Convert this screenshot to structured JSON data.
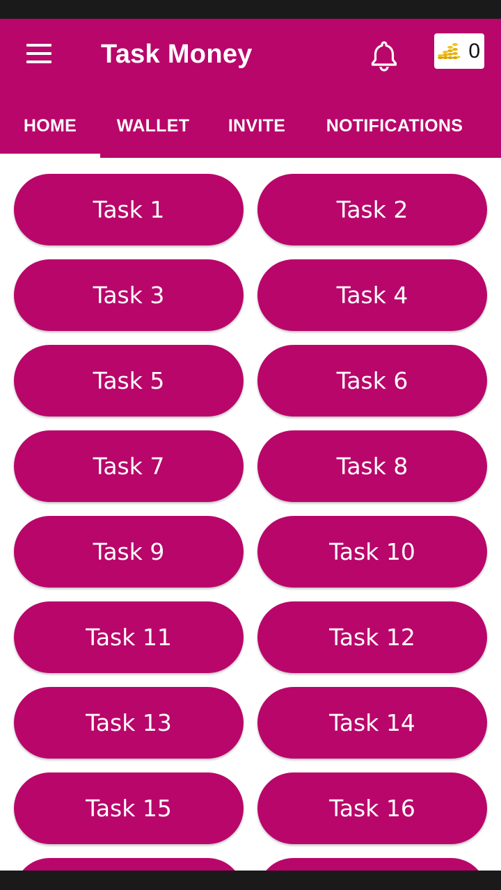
{
  "app": {
    "title": "Task Money",
    "coin_count": "0"
  },
  "colors": {
    "primary": "#b9066a",
    "status_bar": "#1a1a1a",
    "background": "#ffffff"
  },
  "icons": {
    "menu": "menu-icon",
    "bell": "bell-icon",
    "coins": "coins-icon"
  },
  "tabs": [
    {
      "label": "HOME",
      "selected": true
    },
    {
      "label": "WALLET",
      "selected": false
    },
    {
      "label": "INVITE",
      "selected": false
    },
    {
      "label": "NOTIFICATIONS",
      "selected": false
    }
  ],
  "tasks": [
    "Task 1",
    "Task 2",
    "Task 3",
    "Task 4",
    "Task 5",
    "Task 6",
    "Task 7",
    "Task 8",
    "Task 9",
    "Task 10",
    "Task 11",
    "Task 12",
    "Task 13",
    "Task 14",
    "Task 15",
    "Task 16"
  ]
}
